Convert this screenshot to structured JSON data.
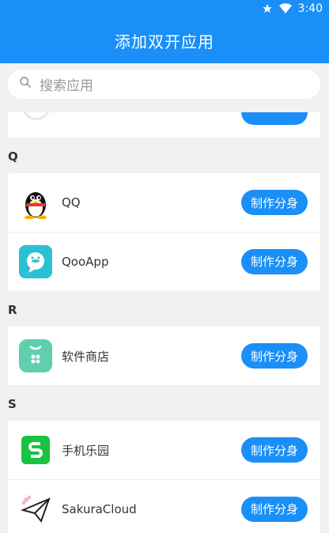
{
  "status": {
    "time": "3:40",
    "icons": [
      "star-icon",
      "wifi-icon"
    ]
  },
  "appbar": {
    "title": "添加双开应用"
  },
  "search": {
    "placeholder": "搜索应用",
    "icon": "search-icon"
  },
  "action_label": "制作分身",
  "sections": [
    {
      "letter": "Q",
      "apps": [
        {
          "name": "QQ",
          "icon": "qq-penguin-icon"
        },
        {
          "name": "QooApp",
          "icon": "qooapp-icon"
        }
      ]
    },
    {
      "letter": "R",
      "apps": [
        {
          "name": "软件商店",
          "icon": "app-store-icon"
        }
      ]
    },
    {
      "letter": "S",
      "apps": [
        {
          "name": "手机乐园",
          "icon": "s-logo-icon"
        },
        {
          "name": "SakuraCloud",
          "icon": "paper-plane-icon"
        }
      ]
    }
  ],
  "colors": {
    "accent": "#1a8ff8",
    "background": "#f1f1f1"
  }
}
